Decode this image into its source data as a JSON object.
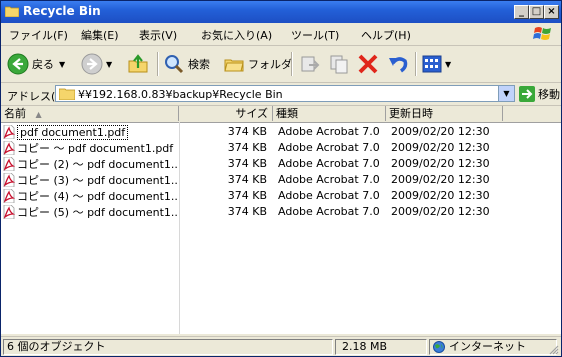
{
  "window": {
    "title": "Recycle Bin"
  },
  "menu": {
    "items": [
      "ファイル(F)",
      "編集(E)",
      "表示(V)",
      "お気に入り(A)",
      "ツール(T)",
      "ヘルプ(H)"
    ]
  },
  "toolbar": {
    "back": "戻る",
    "search": "検索",
    "folders": "フォルダ"
  },
  "address": {
    "label": "アドレス(D)",
    "value": "¥¥192.168.0.83¥backup¥Recycle Bin",
    "go": "移動"
  },
  "columns": {
    "name": "名前",
    "size": "サイズ",
    "type": "種類",
    "modified": "更新日時"
  },
  "files": [
    {
      "name": "pdf document1.pdf",
      "size": "374 KB",
      "type": "Adobe Acrobat 7.0 ...",
      "modified": "2009/02/20 12:30"
    },
    {
      "name": "コピー ～ pdf document1.pdf",
      "size": "374 KB",
      "type": "Adobe Acrobat 7.0 ...",
      "modified": "2009/02/20 12:30"
    },
    {
      "name": "コピー (2) ～ pdf document1...",
      "size": "374 KB",
      "type": "Adobe Acrobat 7.0 ...",
      "modified": "2009/02/20 12:30"
    },
    {
      "name": "コピー (3) ～ pdf document1...",
      "size": "374 KB",
      "type": "Adobe Acrobat 7.0 ...",
      "modified": "2009/02/20 12:30"
    },
    {
      "name": "コピー (4) ～ pdf document1...",
      "size": "374 KB",
      "type": "Adobe Acrobat 7.0 ...",
      "modified": "2009/02/20 12:30"
    },
    {
      "name": "コピー (5) ～ pdf document1...",
      "size": "374 KB",
      "type": "Adobe Acrobat 7.0 ...",
      "modified": "2009/02/20 12:30"
    }
  ],
  "status": {
    "count": "6 個のオブジェクト",
    "size": "2.18 MB",
    "zone": "インターネット"
  },
  "colors": {
    "titlebar": "#2360d8",
    "pdf_red": "#c8102e"
  }
}
